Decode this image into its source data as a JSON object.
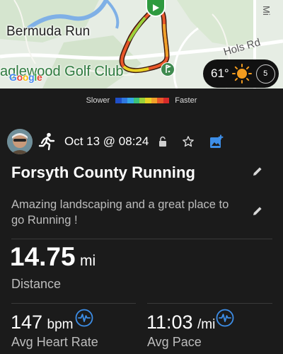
{
  "map": {
    "town_label": "Bermuda Run",
    "golf_label": "aglewood Golf Club",
    "road_label": "Hols Rd",
    "road_label_2": "Mi",
    "attribution": [
      "G",
      "o",
      "o",
      "g",
      "l",
      "e"
    ],
    "weather": {
      "temperature": "61°",
      "icon": "sun-icon",
      "wind_speed": "5"
    }
  },
  "legend": {
    "slower_label": "Slower",
    "faster_label": "Faster",
    "colors": [
      "#1f4fc8",
      "#2f78e0",
      "#34a6e6",
      "#3cc27a",
      "#9ad23a",
      "#e8d224",
      "#f0a12a",
      "#e9572a",
      "#d62a2a"
    ]
  },
  "activity": {
    "date": "Oct 13 @ 08:24",
    "type_icon": "running-icon",
    "title": "Forsyth County Running",
    "description": "Amazing landscaping and a great place to go Running !"
  },
  "stats": {
    "distance": {
      "value": "14.75",
      "unit": "mi",
      "label": "Distance"
    },
    "heart_rate": {
      "value": "147",
      "unit": "bpm",
      "label": "Avg Heart Rate"
    },
    "pace": {
      "value": "11:03",
      "unit": "/mi",
      "label": "Avg Pace"
    }
  },
  "colors": {
    "accent": "#3d8ee8",
    "background": "#1b1b1b",
    "secondary_text": "#bdbdbd"
  }
}
